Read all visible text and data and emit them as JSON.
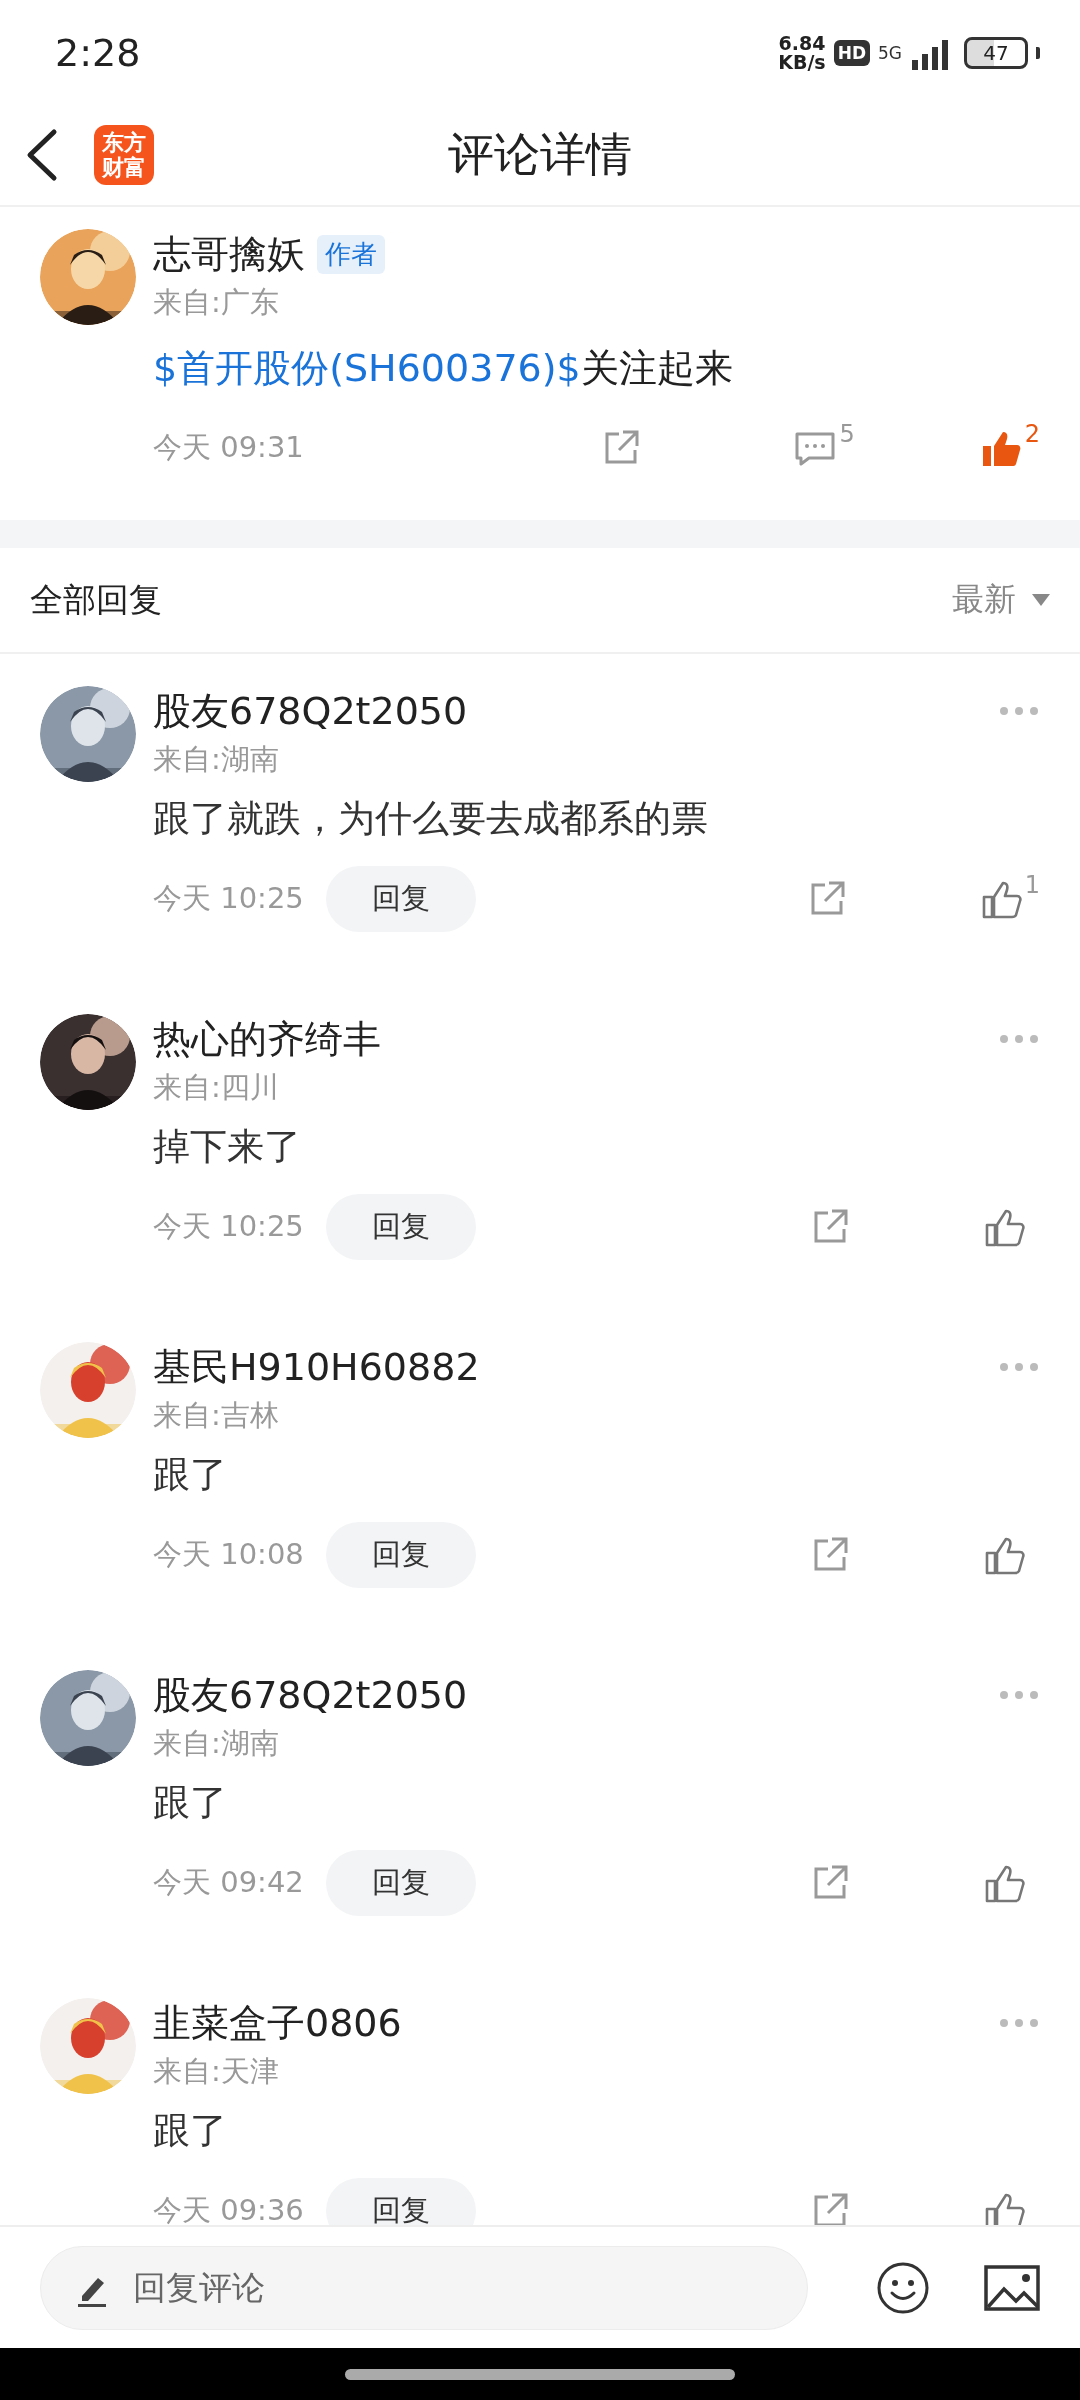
{
  "status_bar": {
    "time": "2:28",
    "speed_value": "6.84",
    "speed_unit": "KB/s",
    "hd_badge": "HD",
    "network": "5G",
    "battery": "47"
  },
  "header": {
    "logo_top": "东方",
    "logo_bottom": "财富",
    "title": "评论详情"
  },
  "post": {
    "author": "志哥擒妖",
    "author_badge": "作者",
    "location": "来自:广东",
    "content": [
      {
        "kind": "stock",
        "text": "$首开股份(SH600376)$"
      },
      {
        "kind": "plain",
        "text": "关注起来"
      }
    ],
    "time": "今天 09:31",
    "comment_count": "5",
    "like_count": "2",
    "liked": true
  },
  "replies_header": {
    "title": "全部回复",
    "sort": "最新"
  },
  "replies": [
    {
      "author": "股友678Q2t2050",
      "location": "来自:湖南",
      "content": "跟了就跌，为什么要去成都系的票",
      "time": "今天 10:25",
      "reply_button": "回复",
      "like_count": "1",
      "liked": false
    },
    {
      "author": "热心的齐绮丰",
      "location": "来自:四川",
      "content": "掉下来了",
      "time": "今天 10:25",
      "reply_button": "回复",
      "liked": false
    },
    {
      "author": "基民H910H60882",
      "location": "来自:吉林",
      "content": "跟了",
      "time": "今天 10:08",
      "reply_button": "回复",
      "liked": false
    },
    {
      "author": "股友678Q2t2050",
      "location": "来自:湖南",
      "content": "跟了",
      "time": "今天 09:42",
      "reply_button": "回复",
      "liked": false
    },
    {
      "author": "韭菜盒子0806",
      "location": "来自:天津",
      "content": "跟了",
      "time": "今天 09:36",
      "reply_button": "回复",
      "liked": false
    }
  ],
  "composer": {
    "placeholder": "回复评论"
  }
}
